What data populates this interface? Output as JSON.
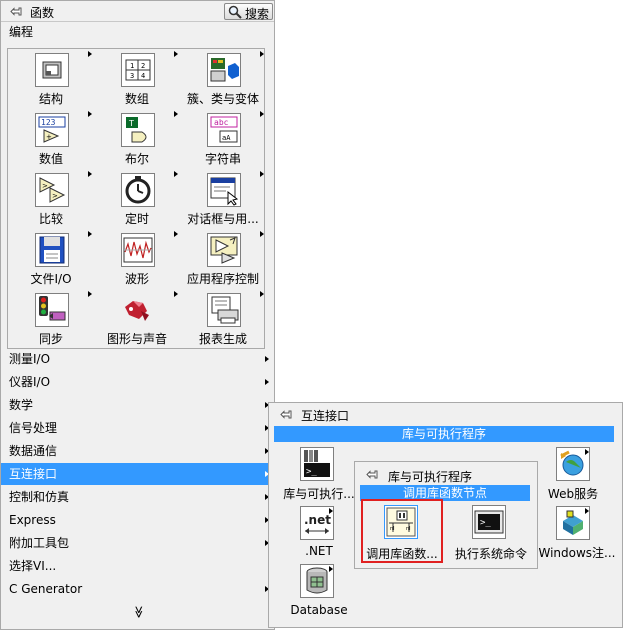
{
  "main_palette": {
    "title": "函数",
    "search_label": "搜索",
    "section": "编程",
    "items": [
      {
        "label": "结构",
        "icon": "structures-icon"
      },
      {
        "label": "数组",
        "icon": "array-icon"
      },
      {
        "label": "簇、类与变体",
        "icon": "cluster-class-variant-icon"
      },
      {
        "label": "数值",
        "icon": "numeric-icon"
      },
      {
        "label": "布尔",
        "icon": "boolean-icon"
      },
      {
        "label": "字符串",
        "icon": "string-icon"
      },
      {
        "label": "比较",
        "icon": "comparison-icon"
      },
      {
        "label": "定时",
        "icon": "timing-icon"
      },
      {
        "label": "对话框与用...",
        "icon": "dialog-ui-icon"
      },
      {
        "label": "文件I/O",
        "icon": "file-io-icon"
      },
      {
        "label": "波形",
        "icon": "waveform-icon"
      },
      {
        "label": "应用程序控制",
        "icon": "app-control-icon"
      },
      {
        "label": "同步",
        "icon": "synchronization-icon"
      },
      {
        "label": "图形与声音",
        "icon": "graphics-sound-icon"
      },
      {
        "label": "报表生成",
        "icon": "report-generation-icon"
      }
    ],
    "categories": [
      "测量I/O",
      "仪器I/O",
      "数学",
      "信号处理",
      "数据通信",
      "互连接口",
      "控制和仿真",
      "Express",
      "附加工具包",
      "选择VI...",
      "C Generator"
    ],
    "selected_category": "互连接口",
    "more_glyph": "≫"
  },
  "interconnect_palette": {
    "title": "互连接口",
    "highlight": "库与可执行程序",
    "items": [
      {
        "label": "库与可执行...",
        "icon": "libraries-executables-icon"
      },
      {
        "label": "Web服务",
        "icon": "web-services-icon"
      },
      {
        "label": ".NET",
        "icon": "dotnet-icon"
      },
      {
        "label": "Windows注...",
        "icon": "windows-registry-icon"
      },
      {
        "label": "Database",
        "icon": "database-icon"
      }
    ],
    "net_icon_text": ".net"
  },
  "lib_palette": {
    "title": "库与可执行程序",
    "highlight": "调用库函数节点",
    "items": [
      {
        "label": "调用库函数...",
        "icon": "call-library-function-icon"
      },
      {
        "label": "执行系统命令",
        "icon": "system-exec-icon"
      }
    ]
  },
  "colors": {
    "selection": "#3399ff",
    "highlight_box": "#e02020",
    "palette_bg": "#f0f0f0"
  }
}
